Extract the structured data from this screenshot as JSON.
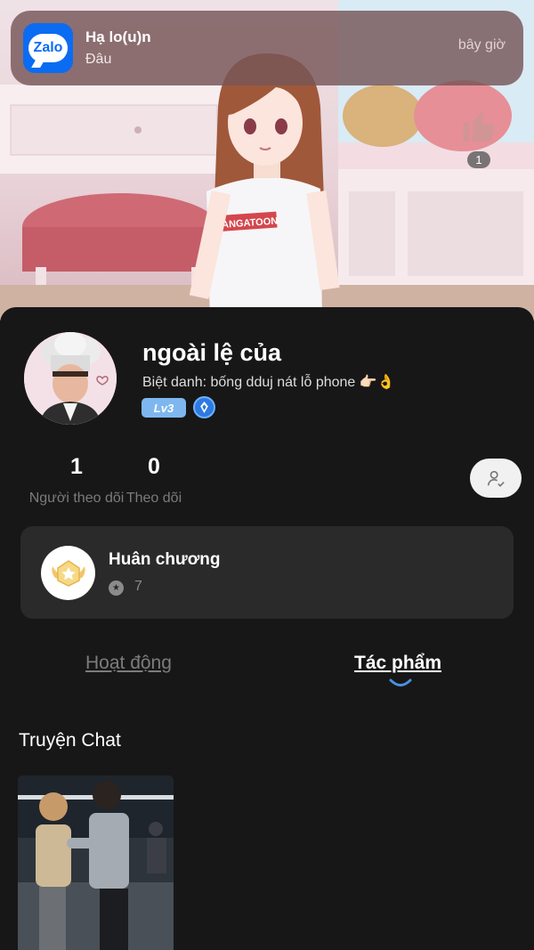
{
  "notification": {
    "app_logo_text": "Zalo",
    "title": "Hạ lo(u)n",
    "body": "Đâu",
    "time": "bây giờ"
  },
  "banner": {
    "shirt_text": "MANGATOON",
    "like_count": "1"
  },
  "profile": {
    "username": "ngoài lệ của",
    "nickname": "Biệt danh: bống dduj nát lỗ phone 👉🏻👌",
    "level": "Lv3"
  },
  "stats": [
    {
      "value": "1",
      "label": "Người theo dõi"
    },
    {
      "value": "0",
      "label": "Theo dõi"
    }
  ],
  "medal": {
    "title": "Huân chương",
    "count": "7"
  },
  "tabs": [
    {
      "label": "Hoạt động",
      "active": false
    },
    {
      "label": "Tác phẩm",
      "active": true
    }
  ],
  "section": {
    "title": "Truyện Chat"
  },
  "colors": {
    "background": "#171717",
    "card": "#2a2a2a",
    "accent_blue": "#4a90e2",
    "level_badge": "#7eb7ef",
    "zalo_blue": "#0b6cf2"
  },
  "icons": {
    "notification_app": "zalo-app-icon",
    "like": "thumbs-up-icon",
    "vip": "diamond-badge-icon",
    "follow": "person-check-icon",
    "medal": "medal-wings-icon",
    "medal_count": "star-circle-icon"
  }
}
